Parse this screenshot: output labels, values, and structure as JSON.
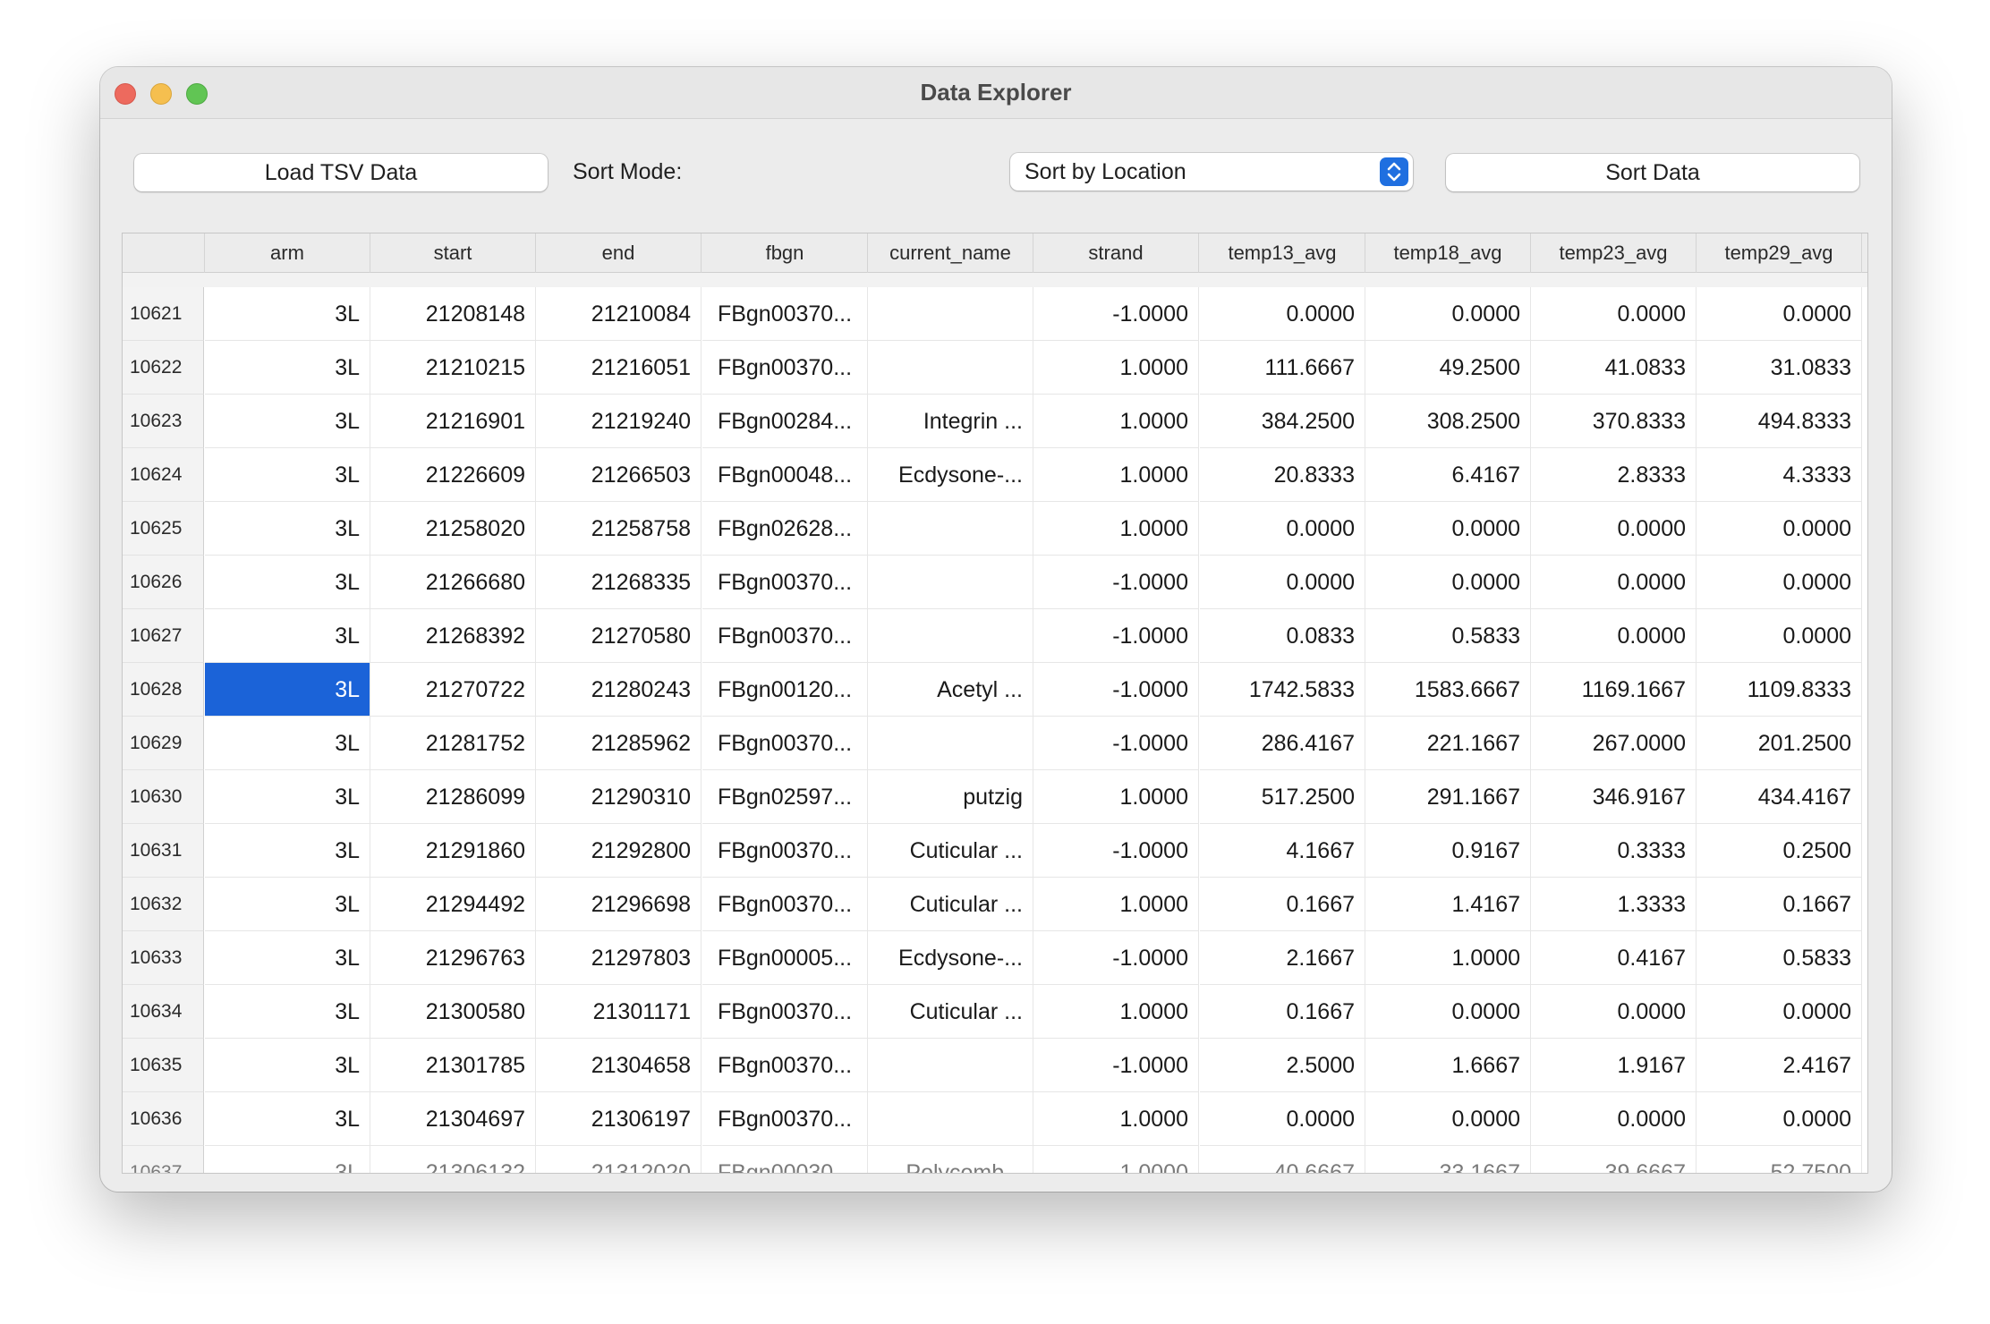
{
  "window": {
    "title": "Data Explorer"
  },
  "toolbar": {
    "load_label": "Load TSV Data",
    "sort_mode_label": "Sort Mode:",
    "sort_mode_value": "Sort by Location",
    "sort_label": "Sort Data"
  },
  "colors": {
    "selection": "#1b63d8",
    "select_arrows": "#1f6fe0"
  },
  "table": {
    "columns": [
      "arm",
      "start",
      "end",
      "fbgn",
      "current_name",
      "strand",
      "temp13_avg",
      "temp18_avg",
      "temp23_avg",
      "temp29_avg"
    ],
    "rows": [
      [
        "10621",
        "3L",
        "21208148",
        "21210084",
        "FBgn00370...",
        "",
        "-1.0000",
        "0.0000",
        "0.0000",
        "0.0000",
        "0.0000"
      ],
      [
        "10622",
        "3L",
        "21210215",
        "21216051",
        "FBgn00370...",
        "",
        "1.0000",
        "111.6667",
        "49.2500",
        "41.0833",
        "31.0833"
      ],
      [
        "10623",
        "3L",
        "21216901",
        "21219240",
        "FBgn00284...",
        "Integrin ...",
        "1.0000",
        "384.2500",
        "308.2500",
        "370.8333",
        "494.8333"
      ],
      [
        "10624",
        "3L",
        "21226609",
        "21266503",
        "FBgn00048...",
        "Ecdysone-...",
        "1.0000",
        "20.8333",
        "6.4167",
        "2.8333",
        "4.3333"
      ],
      [
        "10625",
        "3L",
        "21258020",
        "21258758",
        "FBgn02628...",
        "",
        "1.0000",
        "0.0000",
        "0.0000",
        "0.0000",
        "0.0000"
      ],
      [
        "10626",
        "3L",
        "21266680",
        "21268335",
        "FBgn00370...",
        "",
        "-1.0000",
        "0.0000",
        "0.0000",
        "0.0000",
        "0.0000"
      ],
      [
        "10627",
        "3L",
        "21268392",
        "21270580",
        "FBgn00370...",
        "",
        "-1.0000",
        "0.0833",
        "0.5833",
        "0.0000",
        "0.0000"
      ],
      [
        "10628",
        "3L",
        "21270722",
        "21280243",
        "FBgn00120...",
        "Acetyl ...",
        "-1.0000",
        "1742.5833",
        "1583.6667",
        "1169.1667",
        "1109.8333"
      ],
      [
        "10629",
        "3L",
        "21281752",
        "21285962",
        "FBgn00370...",
        "",
        "-1.0000",
        "286.4167",
        "221.1667",
        "267.0000",
        "201.2500"
      ],
      [
        "10630",
        "3L",
        "21286099",
        "21290310",
        "FBgn02597...",
        "putzig",
        "1.0000",
        "517.2500",
        "291.1667",
        "346.9167",
        "434.4167"
      ],
      [
        "10631",
        "3L",
        "21291860",
        "21292800",
        "FBgn00370...",
        "Cuticular ...",
        "-1.0000",
        "4.1667",
        "0.9167",
        "0.3333",
        "0.2500"
      ],
      [
        "10632",
        "3L",
        "21294492",
        "21296698",
        "FBgn00370...",
        "Cuticular ...",
        "1.0000",
        "0.1667",
        "1.4167",
        "1.3333",
        "0.1667"
      ],
      [
        "10633",
        "3L",
        "21296763",
        "21297803",
        "FBgn00005...",
        "Ecdysone-...",
        "-1.0000",
        "2.1667",
        "1.0000",
        "0.4167",
        "0.5833"
      ],
      [
        "10634",
        "3L",
        "21300580",
        "21301171",
        "FBgn00370...",
        "Cuticular ...",
        "1.0000",
        "0.1667",
        "0.0000",
        "0.0000",
        "0.0000"
      ],
      [
        "10635",
        "3L",
        "21301785",
        "21304658",
        "FBgn00370...",
        "",
        "-1.0000",
        "2.5000",
        "1.6667",
        "1.9167",
        "2.4167"
      ],
      [
        "10636",
        "3L",
        "21304697",
        "21306197",
        "FBgn00370...",
        "",
        "1.0000",
        "0.0000",
        "0.0000",
        "0.0000",
        "0.0000"
      ],
      [
        "10637",
        "3L",
        "21306132",
        "21312020",
        "FBgn00030...",
        "Polycomb...",
        "-1.0000",
        "40.6667",
        "33.1667",
        "39.6667",
        "52.7500"
      ]
    ],
    "selected_row": 7,
    "selected_col": 1
  }
}
